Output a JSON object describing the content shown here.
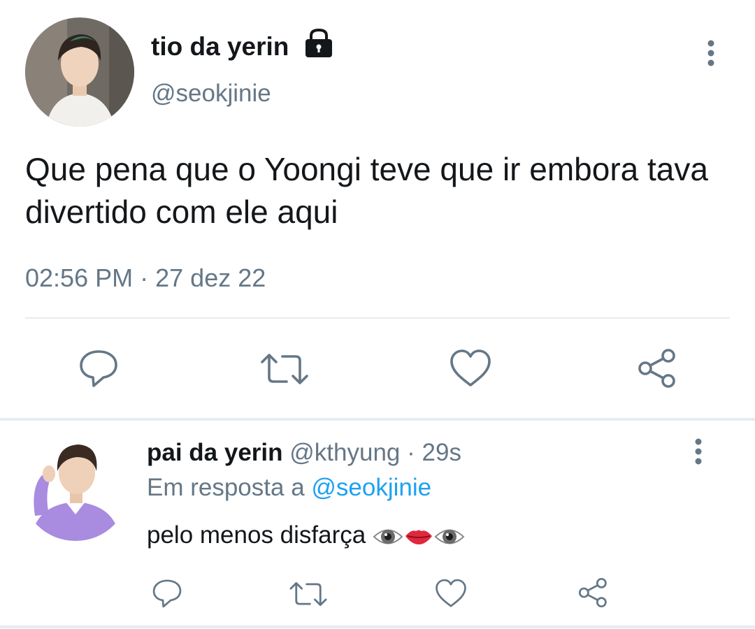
{
  "main_tweet": {
    "display_name": "tio da yerin",
    "handle": "@seokjinie",
    "text": "Que pena que o Yoongi teve que ir embora tava divertido com ele aqui",
    "time": "02:56 PM",
    "separator": "·",
    "date": "27 dez 22",
    "protected_icon": "lock-icon",
    "actions": [
      "reply-icon",
      "retweet-icon",
      "like-icon",
      "share-icon"
    ]
  },
  "reply": {
    "display_name": "pai da yerin",
    "handle": "@kthyung",
    "separator": "·",
    "time_ago": "29s",
    "replying_prefix": "Em resposta a",
    "replying_handle": "@seokjinie",
    "text": "pelo menos disfarça",
    "emojis": [
      "eye-emoji",
      "lips-emoji",
      "eye-emoji"
    ],
    "actions": [
      "reply-icon",
      "retweet-icon",
      "like-icon",
      "share-icon"
    ]
  },
  "colors": {
    "text": "#14171a",
    "secondary": "#657786",
    "link": "#1da1f2",
    "divider": "#e6ecf0"
  }
}
